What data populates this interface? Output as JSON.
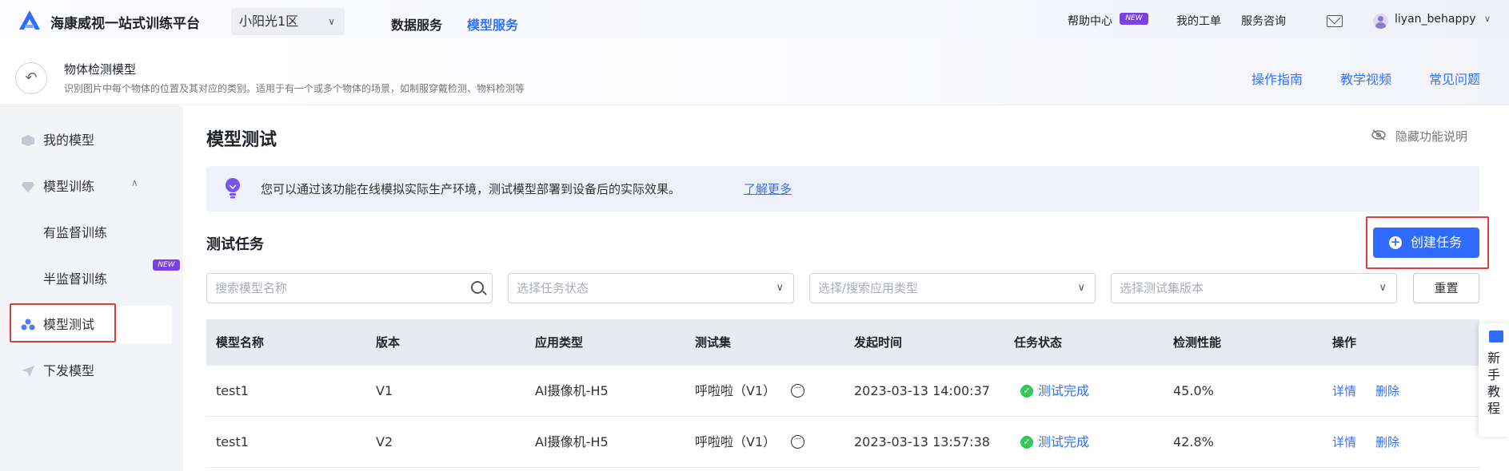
{
  "topbar": {
    "title": "海康威视一站式训练平台",
    "region": "小阳光1区",
    "nav": [
      "数据服务",
      "模型服务"
    ],
    "help": "帮助中心",
    "help_badge": "NEW",
    "tickets": "我的工单",
    "consult": "服务咨询",
    "user": "liyan_behappy"
  },
  "model": {
    "title": "物体检测模型",
    "desc": "识别图片中每个物体的位置及其对应的类别。适用于有一个或多个物体的场景，如制服穿戴检测、物料检测等",
    "links": [
      "操作指南",
      "教学视频",
      "常见问题"
    ]
  },
  "sidebar": {
    "items": [
      {
        "label": "我的模型"
      },
      {
        "label": "模型训练"
      },
      {
        "label": "有监督训练"
      },
      {
        "label": "半监督训练"
      },
      {
        "label": "模型测试"
      },
      {
        "label": "下发模型"
      }
    ],
    "new_badge": "NEW"
  },
  "main": {
    "title": "模型测试",
    "hide_tip": "隐藏功能说明",
    "banner_text": "您可以通过该功能在线模拟实际生产环境，测试模型部署到设备后的实际效果。",
    "learn_more": "了解更多",
    "section_title": "测试任务",
    "create_button": "创建任务",
    "filters": {
      "model_search": "搜索模型名称",
      "status": "选择任务状态",
      "app_type": "选择/搜索应用类型",
      "testset": "选择测试集版本"
    },
    "reset": "重置"
  },
  "table": {
    "columns": [
      "模型名称",
      "版本",
      "应用类型",
      "测试集",
      "发起时间",
      "任务状态",
      "检测性能",
      "操作"
    ],
    "rows": [
      {
        "name": "test1",
        "version": "V1",
        "app": "AI摄像机-H5",
        "testset": "呼啦啦（V1）",
        "time": "2023-03-13 14:00:37",
        "status": "测试完成",
        "perf": "45.0%",
        "op_detail": "详情",
        "op_delete": "删除"
      },
      {
        "name": "test1",
        "version": "V2",
        "app": "AI摄像机-H5",
        "testset": "呼啦啦（V1）",
        "time": "2023-03-13 13:57:38",
        "status": "测试完成",
        "perf": "42.8%",
        "op_detail": "详情",
        "op_delete": "删除"
      }
    ]
  },
  "tutorial": {
    "label": "新手教程"
  },
  "colors": {
    "accent": "#3370ff",
    "button": "#2f6bff",
    "success": "#34c759",
    "badge": "#7b3fe4",
    "highlight": "#e23b3b"
  }
}
